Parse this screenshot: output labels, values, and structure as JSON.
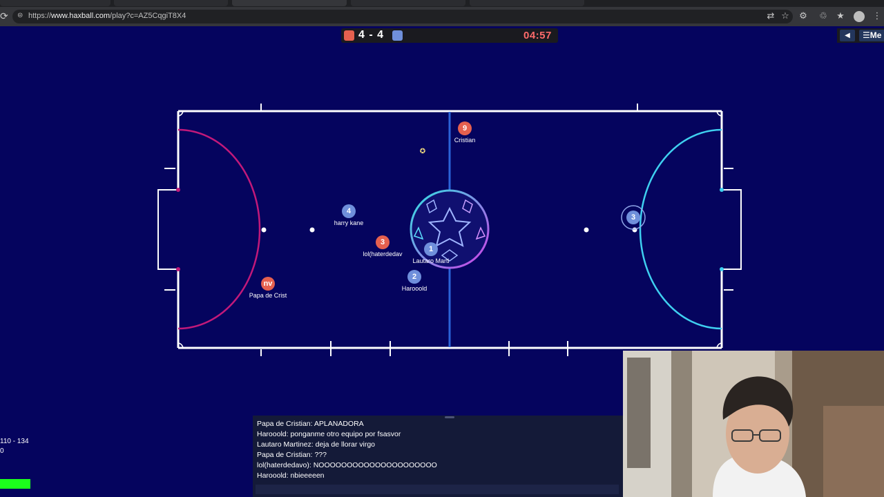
{
  "browser": {
    "url_prefix": "https://",
    "url_domain": "www.haxball.com",
    "url_path": "/play?c=AZ5CqgiT8X4"
  },
  "scoreboard": {
    "score": "4 - 4",
    "timer": "04:57",
    "red_color": "#e5604f",
    "blue_color": "#6f8fdb"
  },
  "menu": {
    "sound_icon": "speaker-icon",
    "menu_label": "Me"
  },
  "players": [
    {
      "number": "9",
      "name": "Cristian",
      "team": "red"
    },
    {
      "number": "4",
      "name": "harry kane",
      "team": "blue"
    },
    {
      "number": "3",
      "name": "lol(haterdedav",
      "team": "red"
    },
    {
      "number": "1",
      "name": "Lautaro Marti",
      "team": "blue"
    },
    {
      "number": "2",
      "name": "Harooold",
      "team": "blue"
    },
    {
      "number": "nv",
      "name": "Papa de Crist",
      "team": "red"
    },
    {
      "number": "3",
      "name": "",
      "team": "blue"
    }
  ],
  "stats": {
    "line1": "110 - 134",
    "line2": "0"
  },
  "chat": {
    "messages": [
      "Papa de Cristian: APLANADORA",
      "Harooold: ponganme otro equipo por fsasvor",
      "Lautaro Martinez: deja de llorar virgo",
      "Papa de Cristian: ???",
      "lol(haterdedavo): NOOOOOOOOOOOOOOOOOOOOO",
      "Harooold: nbieeeeen"
    ]
  }
}
